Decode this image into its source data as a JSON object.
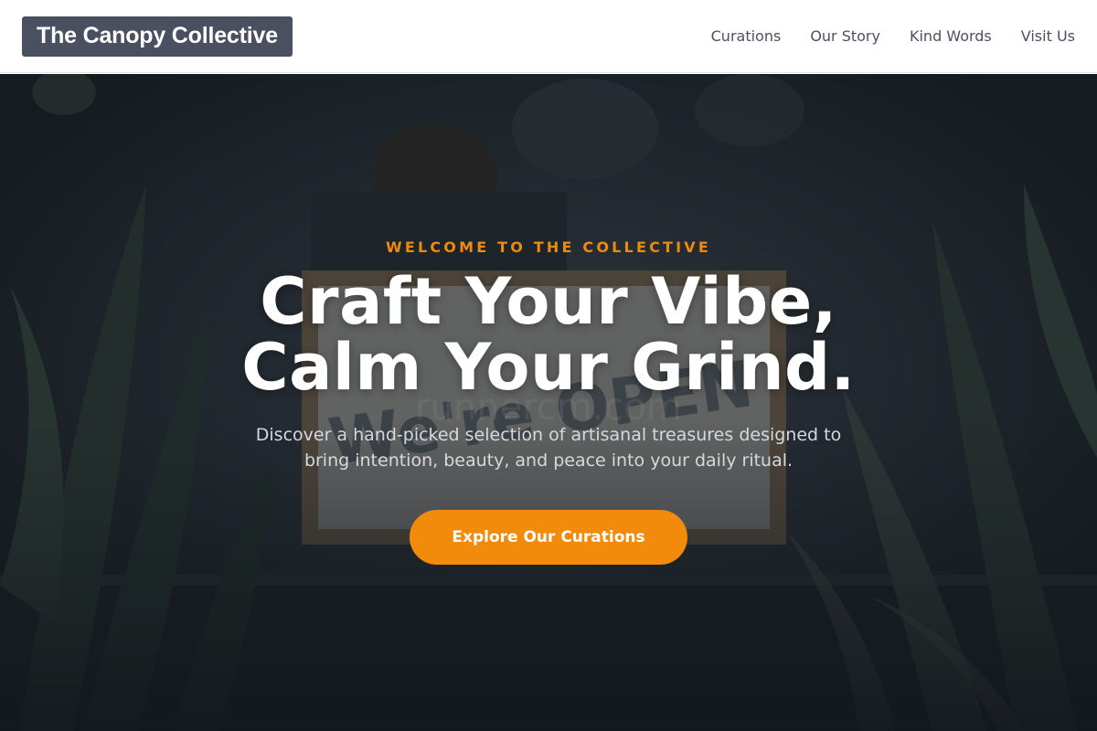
{
  "header": {
    "brand": "The Canopy Collective",
    "nav": [
      {
        "label": "Curations"
      },
      {
        "label": "Our Story"
      },
      {
        "label": "Kind Words"
      },
      {
        "label": "Visit Us"
      }
    ]
  },
  "hero": {
    "eyebrow": "WELCOME TO THE COLLECTIVE",
    "headline_line1": "Craft Your Vibe,",
    "headline_line2": "Calm Your Grind.",
    "subtext": "Discover a hand-picked selection of artisanal treasures designed to bring intention, beauty, and peace into your daily ritual.",
    "cta_label": "Explore Our Curations",
    "background_sign_text": "We're OPEN",
    "watermark_text": "runnercm.com"
  },
  "colors": {
    "accent": "#f28b0c",
    "logo_bg": "#4a5060",
    "nav_text": "#4a5160",
    "hero_dark": "#1d242a"
  }
}
